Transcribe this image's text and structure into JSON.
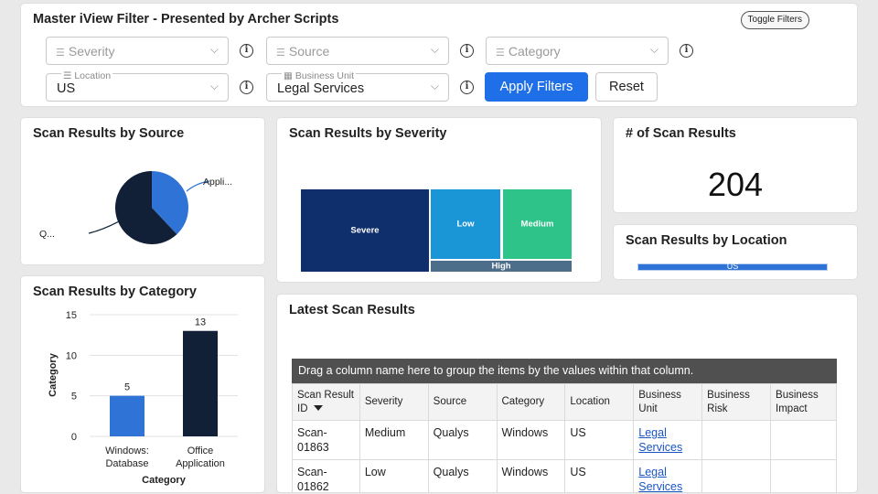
{
  "filters": {
    "title": "Master iView Filter - Presented by Archer Scripts",
    "toggle_label": "Toggle Filters",
    "severity": {
      "placeholder": "Severity"
    },
    "source": {
      "placeholder": "Source"
    },
    "category": {
      "placeholder": "Category"
    },
    "location": {
      "label": "Location",
      "value": "US"
    },
    "business_unit": {
      "label": "Business Unit",
      "value": "Legal Services"
    },
    "apply_label": "Apply Filters",
    "reset_label": "Reset",
    "info_glyph": "i",
    "accent_color": "#1f6fe8"
  },
  "cards": {
    "source_title": "Scan Results by Source",
    "severity_title": "Scan Results by Severity",
    "count_title": "# of Scan Results",
    "count_value": "204",
    "location_title": "Scan Results by Location",
    "category_title": "Scan Results by Category",
    "latest_title": "Latest Scan Results"
  },
  "chart_data": [
    {
      "type": "pie",
      "title": "Scan Results by Source",
      "labels": [
        "Appli...",
        "Q..."
      ],
      "values": [
        38,
        62
      ],
      "colors": [
        "#2f73d6",
        "#112036"
      ]
    },
    {
      "type": "heatmap",
      "subtype": "treemap",
      "title": "Scan Results by Severity",
      "labels": [
        "Severe",
        "Low",
        "Medium",
        "High"
      ],
      "colors": [
        "#0e2f6b",
        "#1a96d6",
        "#2ec389",
        "#4c6e8a"
      ]
    },
    {
      "type": "bar",
      "title": "Scan Results by Location",
      "categories": [
        "US"
      ],
      "values": [
        204
      ],
      "colors": [
        "#2f73d6"
      ]
    },
    {
      "type": "bar",
      "title": "Scan Results by Category",
      "categories": [
        "Windows: Database",
        "Office Application"
      ],
      "values": [
        5,
        13
      ],
      "colors": [
        "#2f73d6",
        "#112036"
      ],
      "ylabel": "Category",
      "xlabel": "Category",
      "ylim": [
        0,
        15
      ],
      "yticks": [
        0,
        5,
        10,
        15
      ],
      "grid": true
    }
  ],
  "table": {
    "group_hint": "Drag a column name here to group the items by the values within that column.",
    "columns": [
      "Scan Result ID",
      "Severity",
      "Source",
      "Category",
      "Location",
      "Business Unit",
      "Business Risk",
      "Business Impact"
    ],
    "rows": [
      [
        "Scan-01863",
        "Medium",
        "Qualys",
        "Windows",
        "US",
        "Legal Services",
        "",
        ""
      ],
      [
        "Scan-01862",
        "Low",
        "Qualys",
        "Windows",
        "US",
        "Legal Services",
        "",
        ""
      ]
    ]
  }
}
